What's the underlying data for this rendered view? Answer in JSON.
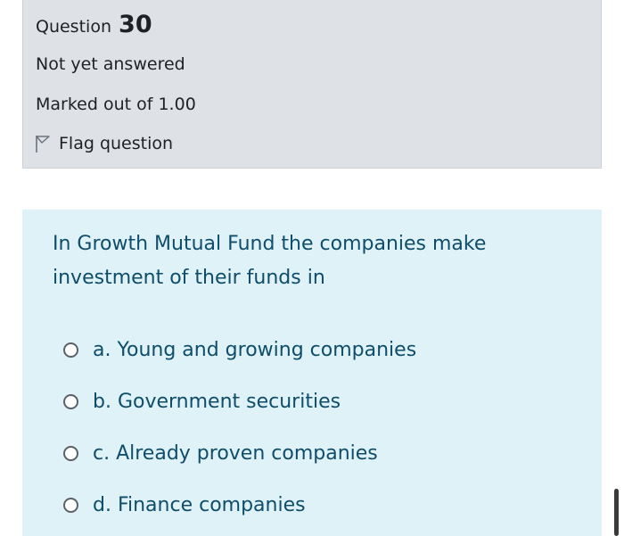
{
  "info": {
    "question_label": "Question",
    "question_number": "30",
    "state": "Not yet answered",
    "grade": "Marked out of 1.00",
    "flag_label": "Flag question",
    "flag_icon": "flag-icon"
  },
  "question": {
    "text": "In Growth Mutual Fund the companies make investment of their funds in",
    "answers": [
      "a. Young and growing companies",
      "b. Government securities",
      "c. Already proven companies",
      "d. Finance companies"
    ]
  },
  "colors": {
    "info_background": "#dee2e6",
    "question_background": "#def2f8",
    "question_text": "#0f4d6a"
  }
}
